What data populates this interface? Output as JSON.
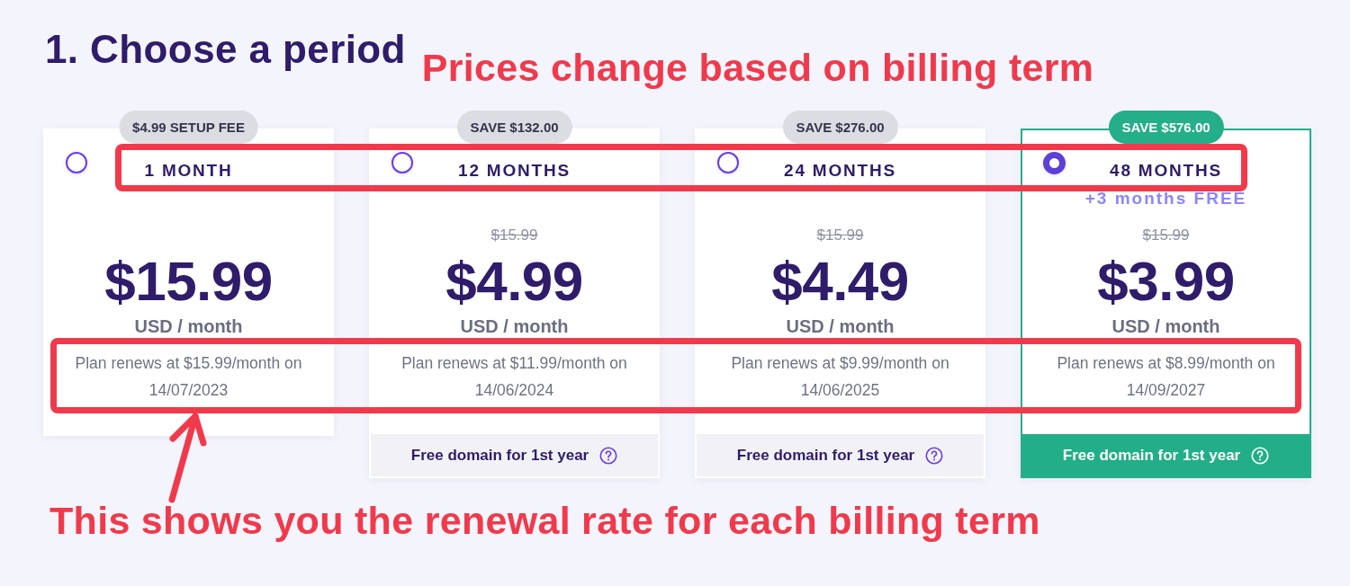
{
  "heading": "1. Choose a period",
  "top_note": "Prices change based on billing term",
  "plans": [
    {
      "badge": "$4.99 SETUP FEE",
      "period": "1 MONTH",
      "price": "$15.99",
      "unit": "USD / month",
      "renewal": "Plan renews at $15.99/month on 14/07/2023",
      "selected": false
    },
    {
      "badge": "SAVE $132.00",
      "period": "12 MONTHS",
      "old_price": "$15.99",
      "price": "$4.99",
      "unit": "USD / month",
      "renewal": "Plan renews at $11.99/month on 14/06/2024",
      "footer": "Free domain for 1st year",
      "selected": false
    },
    {
      "badge": "SAVE $276.00",
      "period": "24 MONTHS",
      "old_price": "$15.99",
      "price": "$4.49",
      "unit": "USD / month",
      "renewal": "Plan renews at $9.99/month on 14/06/2025",
      "footer": "Free domain for 1st year",
      "selected": false
    },
    {
      "badge": "SAVE $576.00",
      "period": "48 MONTHS",
      "bonus": "+3 months FREE",
      "old_price": "$15.99",
      "price": "$3.99",
      "unit": "USD / month",
      "renewal": "Plan renews at $8.99/month on 14/09/2027",
      "footer": "Free domain for 1st year",
      "selected": true
    }
  ],
  "bottom_note": "This shows you the renewal rate for each billing term"
}
